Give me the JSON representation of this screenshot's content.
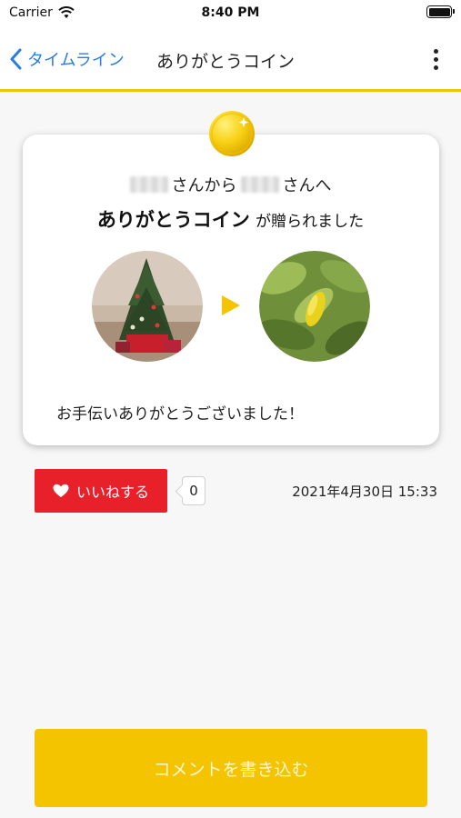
{
  "status_bar": {
    "carrier": "Carrier",
    "time": "8:40 PM",
    "icons": [
      "wifi-icon",
      "battery-icon"
    ]
  },
  "nav": {
    "back_label": "タイムライン",
    "title": "ありがとうコイン",
    "icons": [
      "chevron-left-icon",
      "more-vertical-icon"
    ]
  },
  "card": {
    "sender_suffix": "さんから",
    "receiver_suffix": "さんへ",
    "coin_name": "ありがとうコイン",
    "gifted_text": "が贈られました",
    "message": "お手伝いありがとうございました！",
    "icons": [
      "coin-icon",
      "arrow-right-icon"
    ]
  },
  "like": {
    "label": "いいねする",
    "count": "0",
    "icon": "heart-icon"
  },
  "timestamp": "2021年4月30日 15:33",
  "comment_button": "コメントを書き込む",
  "colors": {
    "accent_yellow": "#f5c400",
    "like_red": "#e8202a",
    "link_blue": "#2a7de1",
    "background": "#f7f7f7"
  }
}
